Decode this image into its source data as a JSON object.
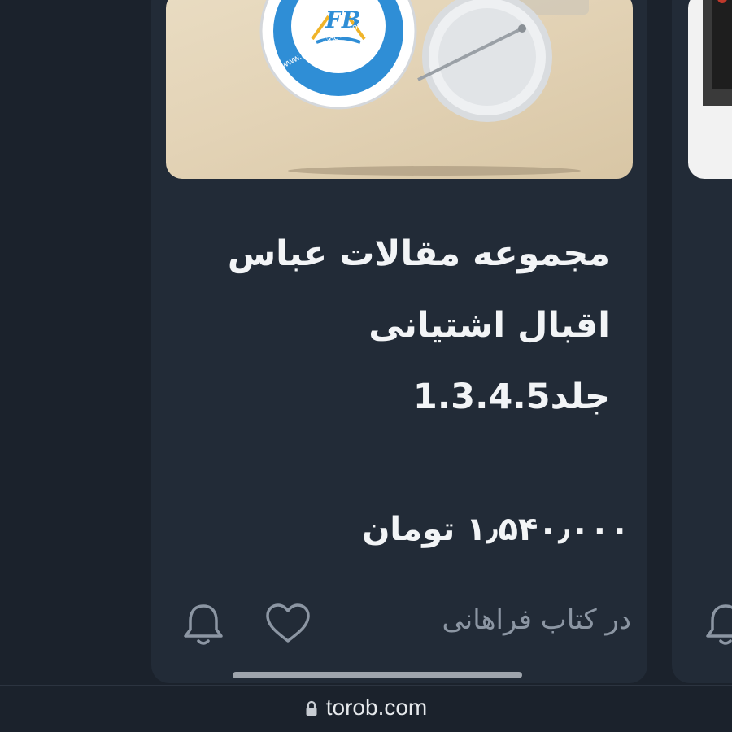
{
  "product": {
    "title_lines": [
      "مجموعه مقالات عباس",
      "اقبال اشتیانی",
      "جلد1.3.4.5"
    ],
    "price": "۱٫۵۴۰٫۰۰۰ تومان",
    "seller": "در کتاب فراهانی",
    "image_badge": {
      "logo_text": "FB",
      "url_text": "www.farahanibook.com"
    }
  },
  "actions": {
    "favorite_icon": "heart-icon",
    "notify_icon": "bell-icon"
  },
  "browser": {
    "url": "torob.com",
    "lock_icon": "lock-icon"
  },
  "colors": {
    "background": "#1b222c",
    "card": "#222b37",
    "text": "#f2f4f6",
    "muted_text": "#8c96a3",
    "badge_blue": "#2f8ed6"
  }
}
